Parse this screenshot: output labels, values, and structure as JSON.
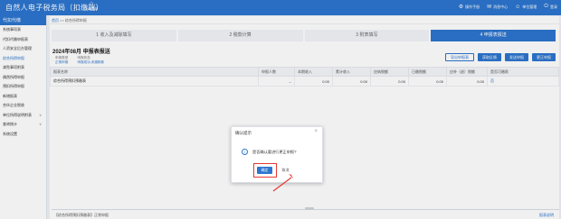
{
  "topbar": {
    "app_title": "自然人电子税务局（扣缴端）",
    "home_label": "首页",
    "home_sub": "功能菜单",
    "tools": [
      {
        "icon": "gear-icon",
        "label": "操作手册"
      },
      {
        "icon": "bell-icon",
        "label": "消息中心"
      },
      {
        "icon": "user-icon",
        "label": "单位管理"
      },
      {
        "icon": "exit-icon",
        "label": "登录"
      }
    ]
  },
  "sidebar": {
    "header": "代扣代缴",
    "items": [
      {
        "label": "系统事项表",
        "color": "normal"
      },
      {
        "label": "代扣代缴申报表",
        "color": "normal"
      },
      {
        "label": "人资安全后台管理",
        "color": "normal"
      },
      {
        "label": "综合所得申报",
        "color": "blue"
      },
      {
        "label": "减免事项附表",
        "color": "normal"
      },
      {
        "label": "偶然所得申报",
        "color": "normal"
      },
      {
        "label": "预扣所得申报",
        "color": "normal"
      },
      {
        "label": "新增报表",
        "color": "normal"
      },
      {
        "label": "合伙企业税收",
        "color": "normal"
      },
      {
        "label": "单位所得说明附表",
        "color": "normal",
        "arrow": "∨"
      },
      {
        "label": "查询统计",
        "color": "normal",
        "arrow": "∨"
      },
      {
        "label": "系统设置",
        "color": "normal"
      }
    ]
  },
  "breadcrumb": {
    "home": "首页",
    "path": ">> 综合所得申报"
  },
  "steps": [
    {
      "label": "1 收入及减除填写",
      "active": false
    },
    {
      "label": "2 税款计算",
      "active": false
    },
    {
      "label": "3 附表填写",
      "active": false
    },
    {
      "label": "4 申报表报送",
      "active": true
    }
  ],
  "period_title": "2024年08月  申报表报送",
  "meta": {
    "type_label": "申报类型",
    "type_value": "正常申报",
    "status_label": "申报状态",
    "status_value": "申报成功,未缴税款"
  },
  "buttons": {
    "export": "导出申报表",
    "obtain": "获取反馈",
    "send": "发送申报",
    "correct": "更正申报"
  },
  "table": {
    "headers": [
      "报表名称",
      "申报人数",
      "本期收入",
      "累计收入",
      "应纳税额",
      "已缴税额",
      "应补（退）税额",
      "是否可缴款"
    ],
    "rows": [
      {
        "name": "综合所得预扣预缴表",
        "people": "--",
        "income": "0.00",
        "cum_income": "0.00",
        "tax": "0.00",
        "paid": "0.00",
        "due": "0.00",
        "action": "否"
      }
    ]
  },
  "footer": {
    "left": "【综合所得预扣预缴表】正常申报",
    "right": "报表说明"
  },
  "dialog": {
    "title": "确认提示",
    "close": "×",
    "message": "是否确认要进行更正申报?",
    "ok": "确定",
    "cancel": "取消"
  },
  "colors": {
    "brand": "#2c75cf",
    "highlight": "#e53935"
  }
}
